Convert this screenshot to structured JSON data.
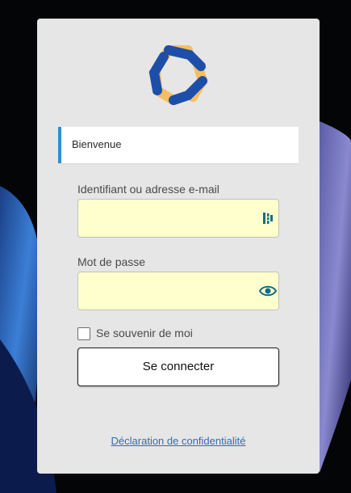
{
  "login": {
    "welcome_message": "Bienvenue",
    "username_label": "Identifiant ou adresse e-mail",
    "username_value": "",
    "password_label": "Mot de passe",
    "password_value": "",
    "remember_label": "Se souvenir de moi",
    "remember_checked": false,
    "submit_label": "Se connecter",
    "privacy_link": "Déclaration de confidentialité"
  },
  "icons": {
    "logo": "hexagonal-knot-logo-icon",
    "username_field": "password-manager-icon",
    "password_toggle": "eye-icon"
  },
  "colors": {
    "panel_bg": "#e6e6e6",
    "field_autofill_bg": "#feffcc",
    "welcome_accent": "#2f8fd0",
    "link": "#2d6fb0",
    "icon_teal": "#0e6e8a",
    "logo_blue": "#1e4fa8",
    "logo_orange": "#f7be61"
  }
}
